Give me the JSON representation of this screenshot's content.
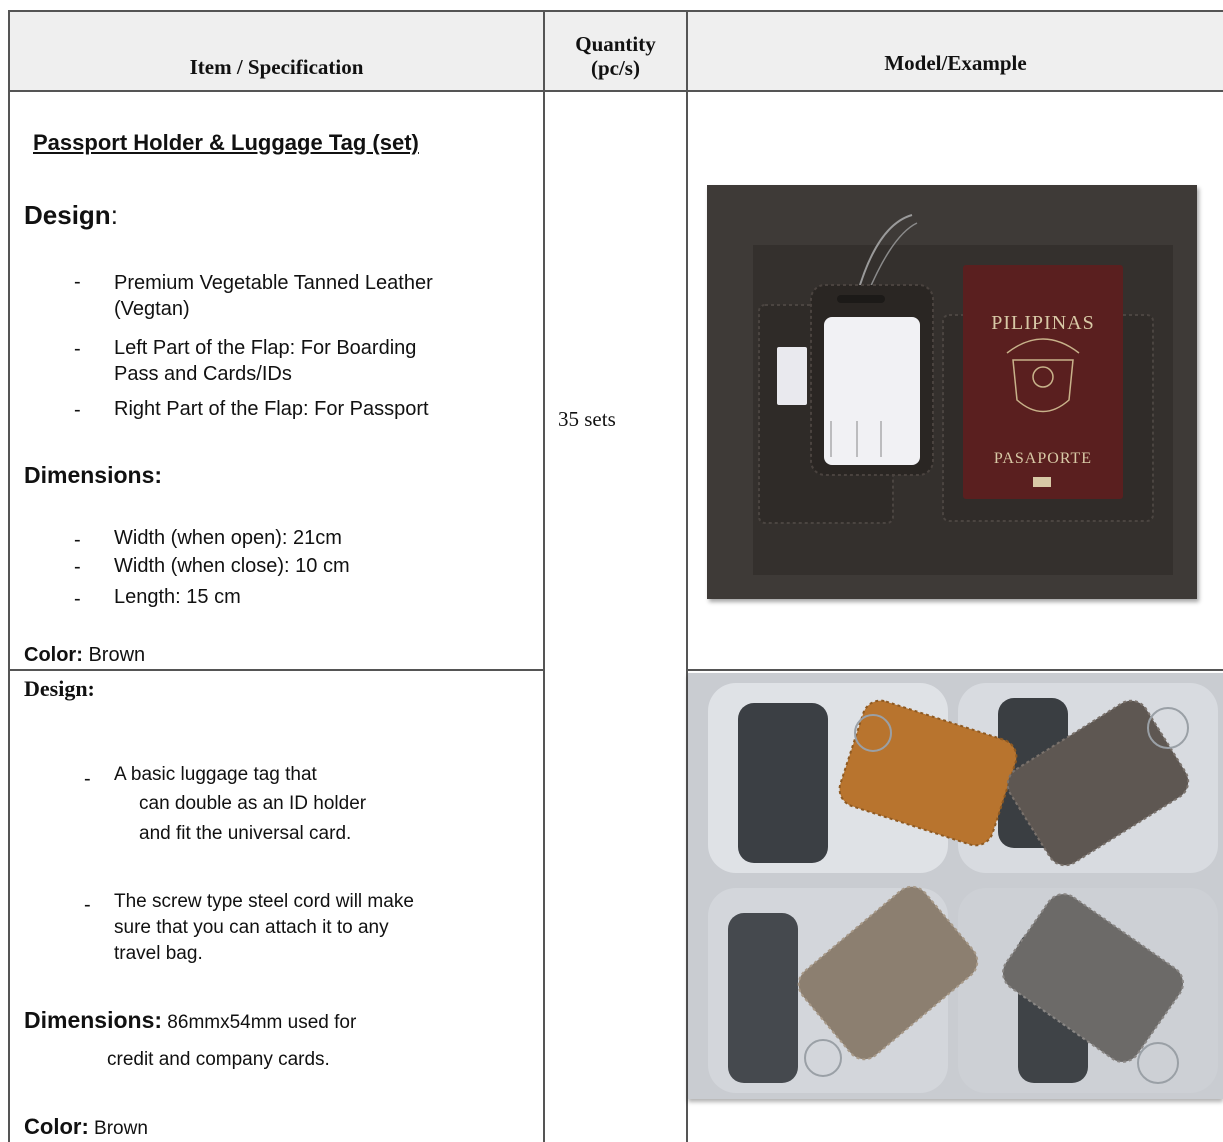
{
  "header": {
    "col1": "Item / Specification",
    "col2_line1": "Quantity",
    "col2_line2": "(pc/s)",
    "col3": "Model/Example"
  },
  "row1": {
    "title": "Passport Holder & Luggage Tag (set)",
    "design_label": "Design",
    "design_colon": ":",
    "design_items": [
      "Premium Vegetable Tanned Leather",
      "(Vegtan)",
      "Left Part of the Flap: For Boarding",
      "Pass and Cards/IDs",
      "Right Part of the Flap: For Passport"
    ],
    "dimensions_label": "Dimensions:",
    "dimension_items": [
      "Width (when open): 21cm",
      "Width (when close): 10 cm",
      "Length: 15 cm"
    ],
    "color_label": "Color:",
    "color_value": " Brown",
    "quantity": "35 sets",
    "photo": {
      "passport_text_top": "PILIPINAS",
      "passport_text_bottom": "PASAPORTE"
    }
  },
  "row2": {
    "design_label": "Design:",
    "design_items": [
      "A basic luggage tag that",
      "can double as an ID holder",
      "and fit the universal card.",
      "The screw type steel cord will make",
      "sure that you can attach it to any",
      "travel bag."
    ],
    "dimensions_label": "Dimensions:",
    "dimensions_value": " 86mmx54mm used for",
    "dimensions_value2": "credit and company cards.",
    "color_label": "Color:",
    "color_value": " Brown"
  },
  "bullet_char": "-",
  "colors": {
    "header_bg": "#efefef",
    "border": "#555555",
    "leather_dark": "#3a3633",
    "passport": "#5a1f1f"
  }
}
